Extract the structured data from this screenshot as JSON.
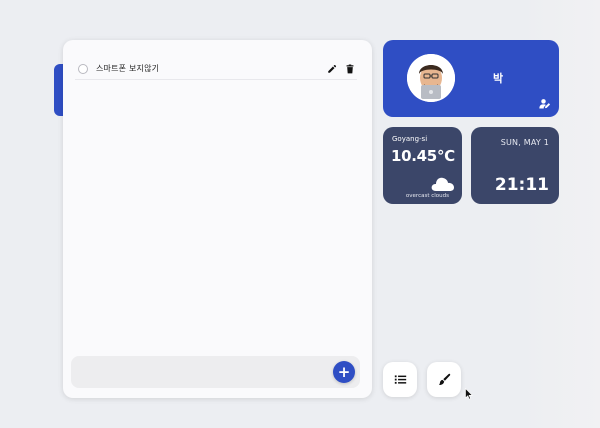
{
  "todo_list": {
    "items": [
      {
        "text": "스마트폰 보지않기",
        "checked": false
      }
    ]
  },
  "input": {
    "value": "",
    "placeholder": "",
    "add_label": "+"
  },
  "profile": {
    "name": "박"
  },
  "weather": {
    "city": "Goyang-si",
    "temperature": "10.45℃",
    "description": "overcast clouds",
    "icon": "cloud-icon"
  },
  "clock": {
    "date": "SUN, MAY 1",
    "time": "21:11"
  },
  "toolbar": {
    "list_icon": "list-icon",
    "theme_icon": "brush-icon"
  },
  "colors": {
    "accent": "#2f4ec4",
    "card_dark": "#3b4669",
    "background": "#eceef2"
  }
}
